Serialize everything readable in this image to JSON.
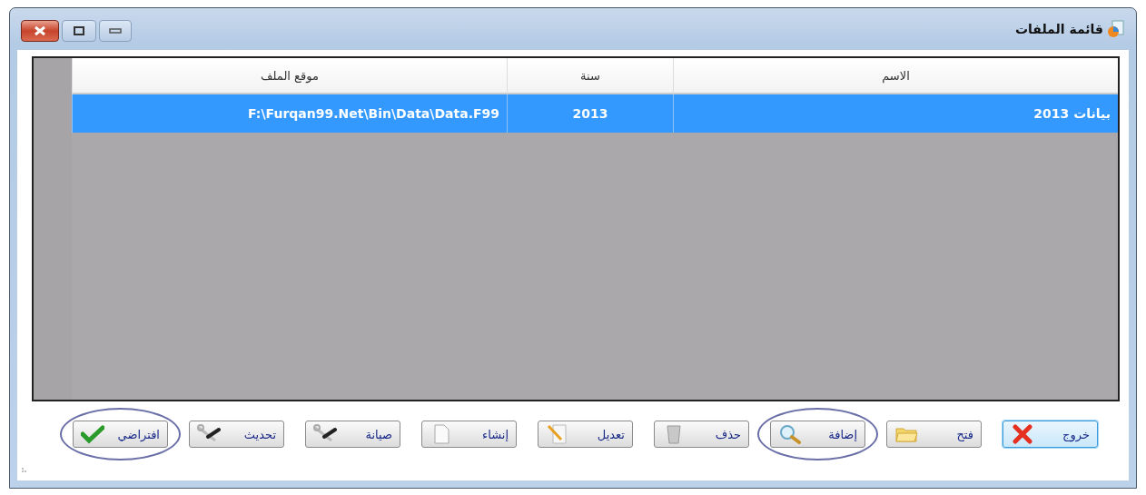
{
  "window": {
    "title": "قائمة الملفات"
  },
  "table": {
    "columns": [
      "الاسم",
      "سنة",
      "موقع الملف"
    ],
    "rows": [
      {
        "cells": [
          "بيانات 2013",
          "2013",
          "F:\\Furqan99.Net\\Bin\\Data\\Data.F99"
        ],
        "selected": true
      }
    ]
  },
  "buttons": [
    {
      "label": "خروج",
      "kind": "exit",
      "focused": true,
      "circled": false
    },
    {
      "label": "فتح",
      "kind": "open",
      "focused": false,
      "circled": false
    },
    {
      "label": "إضافة",
      "kind": "add",
      "focused": false,
      "circled": true
    },
    {
      "label": "حذف",
      "kind": "delete",
      "focused": false,
      "circled": false
    },
    {
      "label": "تعديل",
      "kind": "edit",
      "focused": false,
      "circled": false
    },
    {
      "label": "إنشاء",
      "kind": "create",
      "focused": false,
      "circled": false
    },
    {
      "label": "صيانة",
      "kind": "maintain",
      "focused": false,
      "circled": false
    },
    {
      "label": "تحديث",
      "kind": "update",
      "focused": false,
      "circled": false
    },
    {
      "label": "افتراضي",
      "kind": "default",
      "focused": false,
      "circled": true
    }
  ]
}
